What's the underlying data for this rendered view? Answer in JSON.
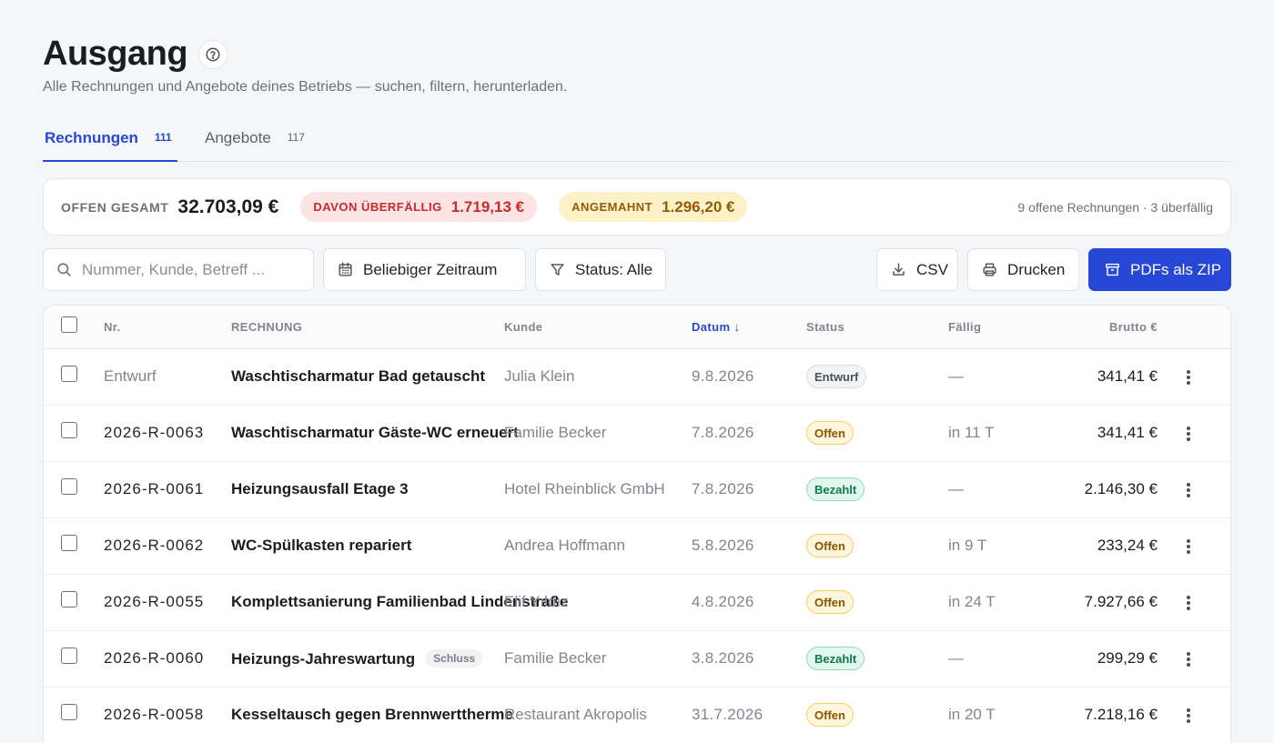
{
  "header": {
    "title": "Ausgang",
    "subtitle": "Alle Rechnungen und Angebote deines Betriebs — suchen, filtern, herunterladen."
  },
  "tabs": [
    {
      "label": "Rechnungen",
      "count": "111",
      "active": true
    },
    {
      "label": "Angebote",
      "count": "117",
      "active": false
    }
  ],
  "summary": {
    "open_label": "OFFEN GESAMT",
    "open_value": "32.703,09 €",
    "overdue_label": "DAVON ÜBERFÄLLIG",
    "overdue_value": "1.719,13 €",
    "reminded_label": "ANGEMAHNT",
    "reminded_value": "1.296,20 €",
    "info": "9 offene Rechnungen · 3 überfällig"
  },
  "toolbar": {
    "search_placeholder": "Nummer, Kunde, Betreff ...",
    "date_label": "Beliebiger Zeitraum",
    "status_label": "Status: Alle",
    "csv_label": "CSV",
    "print_label": "Drucken",
    "zip_label": "PDFs als ZIP"
  },
  "colors": {
    "accent": "#2747d6",
    "overdue": "#c52b2b",
    "reminded": "#925a0a",
    "paid": "#137a50"
  },
  "table": {
    "columns": {
      "nr": "Nr.",
      "rechnung": "RECHNUNG",
      "kunde": "Kunde",
      "datum": "Datum ↓",
      "status": "Status",
      "faellig": "Fällig",
      "brutto": "Brutto €"
    },
    "rows": [
      {
        "nr": "Entwurf",
        "title": "Waschtischarmatur Bad getauscht",
        "tag": "",
        "kunde": "Julia Klein",
        "datum": "9.8.2026",
        "status": "Entwurf",
        "faellig": "—",
        "brutto": "341,41 €"
      },
      {
        "nr": "2026-R-0063",
        "title": "Waschtischarmatur Gäste-WC erneuert",
        "tag": "",
        "kunde": "Familie Becker",
        "datum": "7.8.2026",
        "status": "Offen",
        "faellig": "in 11 T",
        "brutto": "341,41 €"
      },
      {
        "nr": "2026-R-0061",
        "title": "Heizungsausfall Etage 3",
        "tag": "",
        "kunde": "Hotel Rheinblick GmbH",
        "datum": "7.8.2026",
        "status": "Bezahlt",
        "faellig": "—",
        "brutto": "2.146,30 €"
      },
      {
        "nr": "2026-R-0062",
        "title": "WC-Spülkasten repariert",
        "tag": "",
        "kunde": "Andrea Hoffmann",
        "datum": "5.8.2026",
        "status": "Offen",
        "faellig": "in 9 T",
        "brutto": "233,24 €"
      },
      {
        "nr": "2026-R-0055",
        "title": "Komplettsanierung Familienbad Lindenstraße",
        "tag": "",
        "kunde": "Elif Yıldız",
        "datum": "4.8.2026",
        "status": "Offen",
        "faellig": "in 24 T",
        "brutto": "7.927,66 €"
      },
      {
        "nr": "2026-R-0060",
        "title": "Heizungs-Jahreswartung",
        "tag": "Schluss",
        "kunde": "Familie Becker",
        "datum": "3.8.2026",
        "status": "Bezahlt",
        "faellig": "—",
        "brutto": "299,29 €"
      },
      {
        "nr": "2026-R-0058",
        "title": "Kesseltausch gegen Brennwerttherme",
        "tag": "",
        "kunde": "Restaurant Akropolis",
        "datum": "31.7.2026",
        "status": "Offen",
        "faellig": "in 20 T",
        "brutto": "7.218,16 €"
      }
    ]
  }
}
